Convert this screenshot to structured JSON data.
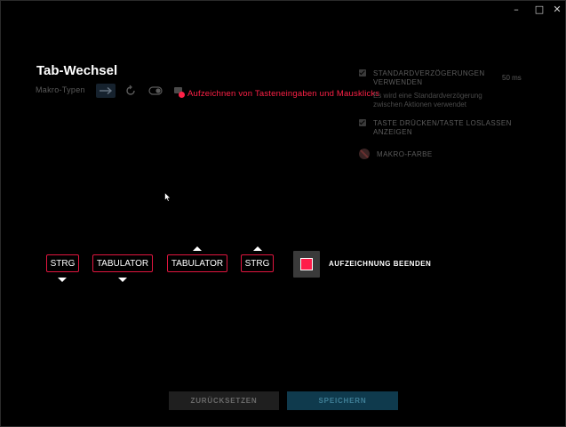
{
  "window": {
    "minimize": "–",
    "maximize": "□",
    "close": "✕"
  },
  "macro": {
    "title": "Tab-Wechsel",
    "types_label": "Makro-Typen",
    "recording_hint": "Aufzeichnen von Tasteneingaben und Mausklicks"
  },
  "options": {
    "default_delays_line1": "STANDARDVERZÖGERUNGEN",
    "default_delays_line2": "VERWENDEN",
    "default_delays_value": "50 ms",
    "default_delays_desc_line1": "Es wird eine Standardverzögerung",
    "default_delays_desc_line2": "zwischen Aktionen verwendet",
    "keypress_line1": "TASTE DRÜCKEN/TASTE LOSLASSEN",
    "keypress_line2": "ANZEIGEN",
    "macro_color": "MAKRO-FARBE"
  },
  "sequence": [
    {
      "label": "STRG",
      "direction": "down"
    },
    {
      "label": "TABULATOR",
      "direction": "down"
    },
    {
      "label": "TABULATOR",
      "direction": "up"
    },
    {
      "label": "STRG",
      "direction": "up"
    }
  ],
  "recording": {
    "stop_label": "AUFZEICHNUNG BEENDEN"
  },
  "footer": {
    "reset": "ZURÜCKSETZEN",
    "save": "SPEICHERN"
  },
  "colors": {
    "accent": "#ff2147",
    "save_bg": "#0f3a4d"
  }
}
